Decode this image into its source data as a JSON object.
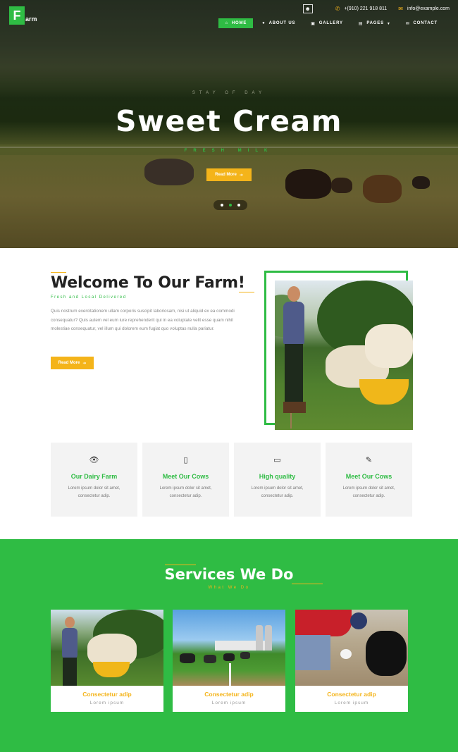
{
  "brand": {
    "logo_letter": "F",
    "logo_text": "arm"
  },
  "topbar": {
    "phone": "+(910) 221 918 811",
    "email": "info@example.com"
  },
  "nav": [
    {
      "icon": "home-icon",
      "label": "HOME",
      "active": true
    },
    {
      "icon": "user-circle-icon",
      "label": "ABOUT US",
      "active": false
    },
    {
      "icon": "image-icon",
      "label": "GALLERY",
      "active": false
    },
    {
      "icon": "file-icon",
      "label": "PAGES",
      "active": false
    },
    {
      "icon": "envelope-icon",
      "label": "CONTACT",
      "active": false
    }
  ],
  "hero": {
    "tagline": "STAY OF DAY",
    "title": "Sweet Cream",
    "subtitle": "FRESH MILK",
    "button": "Read More",
    "slides": 3,
    "active_slide": 2
  },
  "welcome": {
    "title": "Welcome To Our Farm!",
    "subtitle": "Fresh and Local Delivered",
    "body": "Quis nostrum exercitationem ullam corporis suscipit laboriosam, nisi ut aliquid ex ea commodi consequatur? Quis autem vel eum iure reprehenderit qui in ea voluptate velit esse quam nihil molestiae consequatur, vel illum qui dolorem eum fugiat quo voluptas nulla pariatur.",
    "button": "Read More"
  },
  "features": [
    {
      "icon": "eye-icon",
      "title": "Our Dairy Farm",
      "desc": "Lorem ipsum dolor sit amet, consectetur adip."
    },
    {
      "icon": "tablet-icon",
      "title": "Meet Our Cows",
      "desc": "Lorem ipsum dolor sit amet, consectetur adip."
    },
    {
      "icon": "eraser-icon",
      "title": "High quality",
      "desc": "Lorem ipsum dolor sit amet, consectetur adip."
    },
    {
      "icon": "edit-icon",
      "title": "Meet Our Cows",
      "desc": "Lorem ipsum dolor sit amet, consectetur adip."
    }
  ],
  "services": {
    "title": "Services We Do",
    "subtitle": "What We Do",
    "cards": [
      {
        "title": "Consectetur adip",
        "desc": "Lorem ipsum"
      },
      {
        "title": "Consectetur adip",
        "desc": "Lorem ipsum"
      },
      {
        "title": "Consectetur adip",
        "desc": "Lorem ipsum"
      }
    ]
  },
  "colors": {
    "accent_green": "#2fbc44",
    "accent_yellow": "#f4b41a"
  }
}
